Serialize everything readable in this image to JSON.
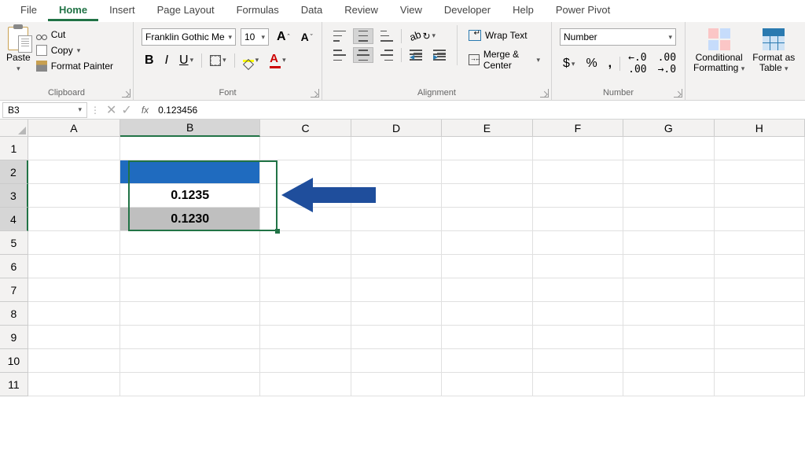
{
  "tabs": [
    "File",
    "Home",
    "Insert",
    "Page Layout",
    "Formulas",
    "Data",
    "Review",
    "View",
    "Developer",
    "Help",
    "Power Pivot"
  ],
  "active_tab": 1,
  "clipboard": {
    "paste": "Paste",
    "cut": "Cut",
    "copy": "Copy",
    "fp": "Format Painter",
    "label": "Clipboard"
  },
  "font": {
    "name": "Franklin Gothic Me",
    "size": "10",
    "label": "Font",
    "b": "B",
    "i": "I",
    "u": "U"
  },
  "alignment": {
    "label": "Alignment",
    "wrap": "Wrap Text",
    "merge": "Merge & Center"
  },
  "number": {
    "label": "Number",
    "format": "Number",
    "currency": "$",
    "percent": "%",
    "comma": ",",
    "dec_inc": ".00→.0",
    "dec_dec": ".0→.00"
  },
  "styles": {
    "cond": "Conditional\nFormatting",
    "table": "Format as\nTable"
  },
  "namebox": "B3",
  "formula": "0.123456",
  "cols": [
    "A",
    "B",
    "C",
    "D",
    "E",
    "F",
    "G",
    "H"
  ],
  "cells": {
    "B3": "0.1235",
    "B4": "0.1230"
  }
}
